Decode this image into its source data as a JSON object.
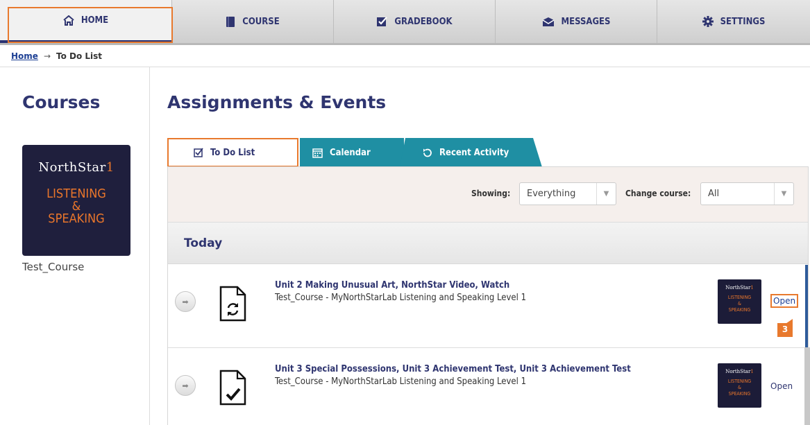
{
  "nav": {
    "items": [
      {
        "label": "HOME",
        "icon": "home-icon",
        "active": true
      },
      {
        "label": "COURSE",
        "icon": "book-icon",
        "active": false
      },
      {
        "label": "GRADEBOOK",
        "icon": "checkbox-icon",
        "active": false
      },
      {
        "label": "MESSAGES",
        "icon": "envelope-icon",
        "active": false
      },
      {
        "label": "SETTINGS",
        "icon": "gear-icon",
        "active": false
      }
    ]
  },
  "breadcrumb": {
    "home": "Home",
    "separator": "→",
    "current": "To Do List"
  },
  "sidebar": {
    "title": "Courses",
    "course_card": {
      "brand": "NorthStar",
      "level": "1",
      "line1": "LISTENING",
      "line2": "&",
      "line3": "SPEAKING"
    },
    "course_name": "Test_Course"
  },
  "main": {
    "title": "Assignments & Events",
    "tabs": [
      {
        "label": "To Do List",
        "icon": "checkbox-icon"
      },
      {
        "label": "Calendar",
        "icon": "calendar-icon"
      },
      {
        "label": "Recent Activity",
        "icon": "refresh-icon"
      }
    ],
    "filters": {
      "showing_label": "Showing:",
      "showing_value": "Everything",
      "course_label": "Change course:",
      "course_value": "All"
    },
    "section": "Today",
    "rows": [
      {
        "title": "Unit 2 Making Unusual Art, NorthStar Video, Watch",
        "subtitle": "Test_Course - MyNorthStarLab Listening and Speaking Level 1",
        "open_label": "Open",
        "icon": "document-refresh-icon"
      },
      {
        "title": "Unit 3 Special Possessions, Unit 3 Achievement Test, Unit 3 Achievement Test",
        "subtitle": "Test_Course - MyNorthStarLab Listening and Speaking Level 1",
        "open_label": "Open",
        "icon": "document-check-icon"
      }
    ],
    "thumb": {
      "brand": "NorthStar",
      "level": "1",
      "line1": "LISTENING",
      "line2": "&",
      "line3": "SPEAKING"
    }
  },
  "callout": {
    "number": "3"
  },
  "colors": {
    "navy": "#2f3570",
    "orange": "#e8792d",
    "teal": "#1f8fa3",
    "link": "#1c3f94"
  }
}
